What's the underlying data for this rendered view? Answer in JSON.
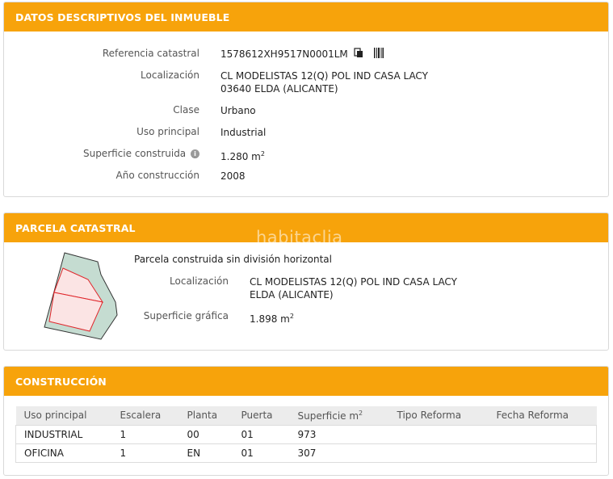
{
  "descriptive": {
    "title": "DATOS DESCRIPTIVOS DEL INMUEBLE",
    "labels": {
      "referencia": "Referencia catastral",
      "localizacion": "Localización",
      "clase": "Clase",
      "uso": "Uso principal",
      "superficie": "Superficie construida",
      "anio": "Año construcción"
    },
    "values": {
      "referencia": "1578612XH9517N0001LM",
      "localizacion_line1": "CL MODELISTAS 12(Q) POL IND CASA LACY",
      "localizacion_line2": "03640 ELDA (ALICANTE)",
      "clase": "Urbano",
      "uso": "Industrial",
      "superficie": "1.280 m",
      "superficie_exp": "2",
      "anio": "2008"
    },
    "icons": [
      "copy-icon",
      "barcode-icon",
      "info-icon"
    ]
  },
  "parcela": {
    "title": "PARCELA CATASTRAL",
    "watermark": "habitaclia",
    "description": "Parcela construida sin división horizontal",
    "labels": {
      "localizacion": "Localización",
      "superficie": "Superficie gráfica"
    },
    "values": {
      "localizacion_line1": "CL MODELISTAS 12(Q) POL IND CASA LACY",
      "localizacion_line2": "ELDA (ALICANTE)",
      "superficie": "1.898 m",
      "superficie_exp": "2"
    },
    "colors": {
      "parcel_fill": "#c5dcd1",
      "building_fill": "#fbe4e4",
      "building_stroke": "#e0262b"
    }
  },
  "construccion": {
    "title": "CONSTRUCCIÓN",
    "headers": [
      "Uso principal",
      "Escalera",
      "Planta",
      "Puerta",
      "Superficie m",
      "Tipo Reforma",
      "Fecha Reforma"
    ],
    "header_exp": "2",
    "rows": [
      [
        "INDUSTRIAL",
        "1",
        "00",
        "01",
        "973",
        "",
        ""
      ],
      [
        "OFICINA",
        "1",
        "EN",
        "01",
        "307",
        "",
        ""
      ]
    ]
  },
  "colors": {
    "accent": "#f7a30b"
  }
}
